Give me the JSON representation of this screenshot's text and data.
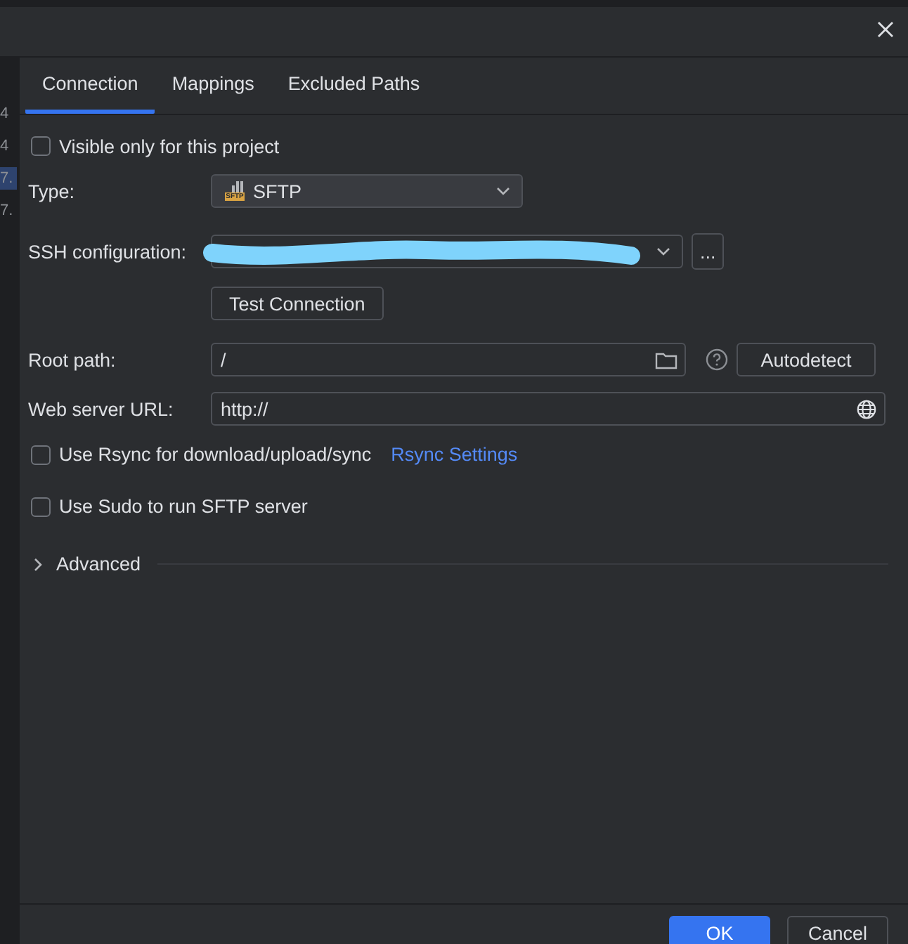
{
  "gutter_lines": [
    {
      "text": "4",
      "selected": false
    },
    {
      "text": "4",
      "selected": false
    },
    {
      "text": "7.",
      "selected": true
    },
    {
      "text": "7.",
      "selected": false
    }
  ],
  "tabs": [
    {
      "label": "Connection",
      "selected": true
    },
    {
      "label": "Mappings",
      "selected": false
    },
    {
      "label": "Excluded Paths",
      "selected": false
    }
  ],
  "visible_only": {
    "label": "Visible only for this project",
    "checked": false
  },
  "type": {
    "label": "Type:",
    "value": "SFTP",
    "badge": "SFTP"
  },
  "ssh_configuration": {
    "label": "SSH configuration:",
    "redacted": true,
    "more_button": "..."
  },
  "test_button": "Test Connection",
  "root_path": {
    "label": "Root path:",
    "value": "/",
    "autodetect_button": "Autodetect"
  },
  "web_server_url": {
    "label": "Web server URL:",
    "value": "http://"
  },
  "rsync": {
    "label": "Use Rsync for download/upload/sync",
    "checked": false,
    "link": "Rsync Settings"
  },
  "sudo": {
    "label": "Use Sudo to run SFTP server",
    "checked": false
  },
  "advanced": {
    "label": "Advanced",
    "expanded": false
  },
  "buttons": [
    {
      "label": "OK",
      "kind": "primary"
    },
    {
      "label": "Cancel",
      "kind": "secondary"
    }
  ]
}
